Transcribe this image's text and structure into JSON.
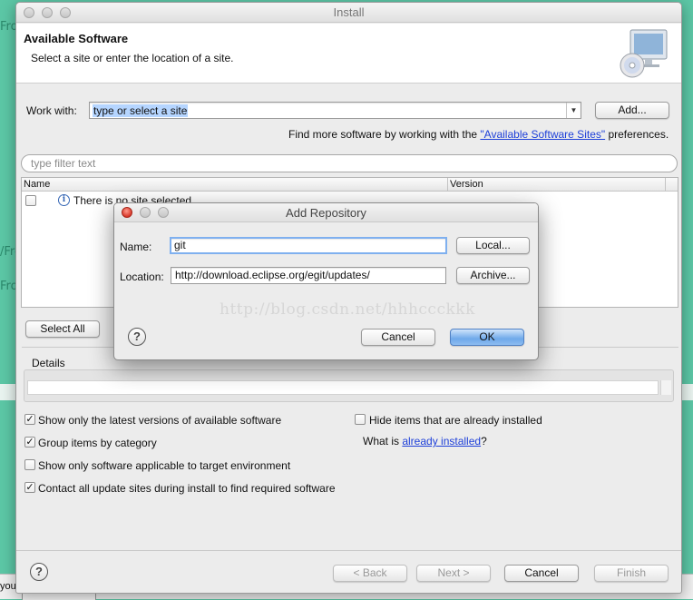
{
  "background": {
    "fragments": [
      "Fro",
      "/Fro",
      "Fro",
      "you"
    ]
  },
  "window": {
    "title": "Install",
    "header": {
      "title": "Available Software",
      "subtitle": "Select a site or enter the location of a site."
    },
    "work_with": {
      "label": "Work with:",
      "value": "type or select a site",
      "add_button": "Add..."
    },
    "find_more": {
      "prefix": "Find more software by working with the ",
      "link": "\"Available Software Sites\"",
      "suffix": " preferences."
    },
    "filter_placeholder": "type filter text",
    "table": {
      "columns": [
        "Name",
        "Version"
      ],
      "rows": [
        {
          "text": "There is no site selected."
        }
      ]
    },
    "select_all": "Select All",
    "details_label": "Details",
    "options": {
      "latest_versions": {
        "label": "Show only the latest versions of available software",
        "checked": true
      },
      "group_by_category": {
        "label": "Group items by category",
        "checked": true
      },
      "target_env": {
        "label": "Show only software applicable to target environment",
        "checked": false
      },
      "contact_sites": {
        "label": "Contact all update sites during install to find required software",
        "checked": true
      },
      "hide_installed": {
        "label": "Hide items that are already installed",
        "checked": false
      }
    },
    "what_is": {
      "prefix": "What is ",
      "link": "already installed",
      "suffix": "?"
    },
    "footer": {
      "back": "< Back",
      "next": "Next >",
      "cancel": "Cancel",
      "finish": "Finish"
    }
  },
  "dialog": {
    "title": "Add Repository",
    "name_label": "Name:",
    "name_value": "git",
    "local_button": "Local...",
    "location_label": "Location:",
    "location_value": "http://download.eclipse.org/egit/updates/",
    "archive_button": "Archive...",
    "watermark": "http://blog.csdn.net/hhhccckkk",
    "cancel_button": "Cancel",
    "ok_button": "OK"
  },
  "colors": {
    "desktop": "#5cc7a6",
    "link": "#1d3fd9",
    "default_button": "#6fa9ea"
  }
}
